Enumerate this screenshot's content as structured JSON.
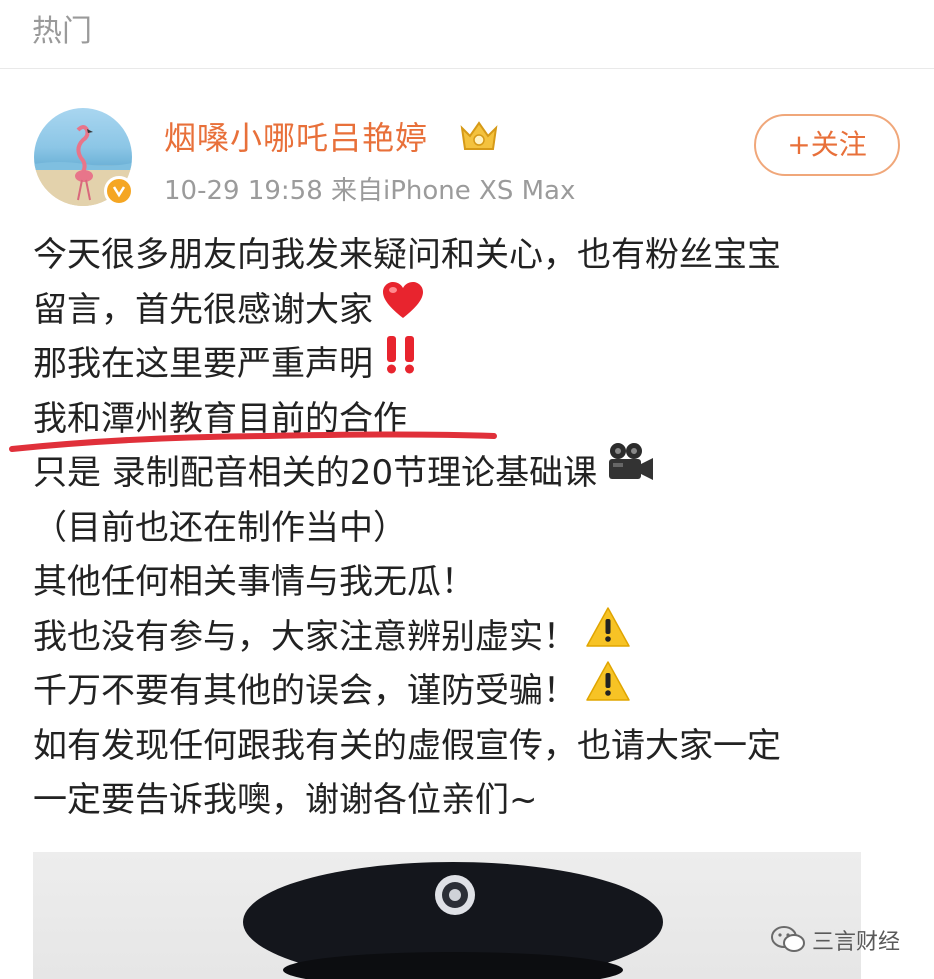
{
  "header": {
    "title": "热门"
  },
  "post": {
    "username": "烟嗓小哪吒吕艳婷",
    "meta": "10-29 19:58  来自iPhone XS Max",
    "follow_label": "+关注",
    "lines": [
      "今天很多朋友向我发来疑问和关心，也有粉丝宝宝",
      "留言，首先很感谢大家",
      "那我在这里要严重声明",
      "我和潭州教育目前的合作",
      "只是  录制配音相关的20节理论基础课",
      "（目前也还在制作当中）",
      "其他任何相关事情与我无瓜！",
      "我也没有参与，大家注意辨别虚实！",
      "千万不要有其他的误会，谨防受骗！",
      "如有发现任何跟我有关的虚假宣传，也请大家一定",
      "一定要告诉我噢，谢谢各位亲们~"
    ],
    "line_emojis": [
      "",
      "heart-icon",
      "double-exclamation-icon",
      "",
      "movie-camera-icon",
      "",
      "",
      "warning-icon",
      "warning-icon",
      "",
      ""
    ]
  },
  "watermark": {
    "text": "三言财经"
  },
  "colors": {
    "username": "#e8703a",
    "underline": "#e0303a",
    "meta": "#9b9b9b"
  }
}
